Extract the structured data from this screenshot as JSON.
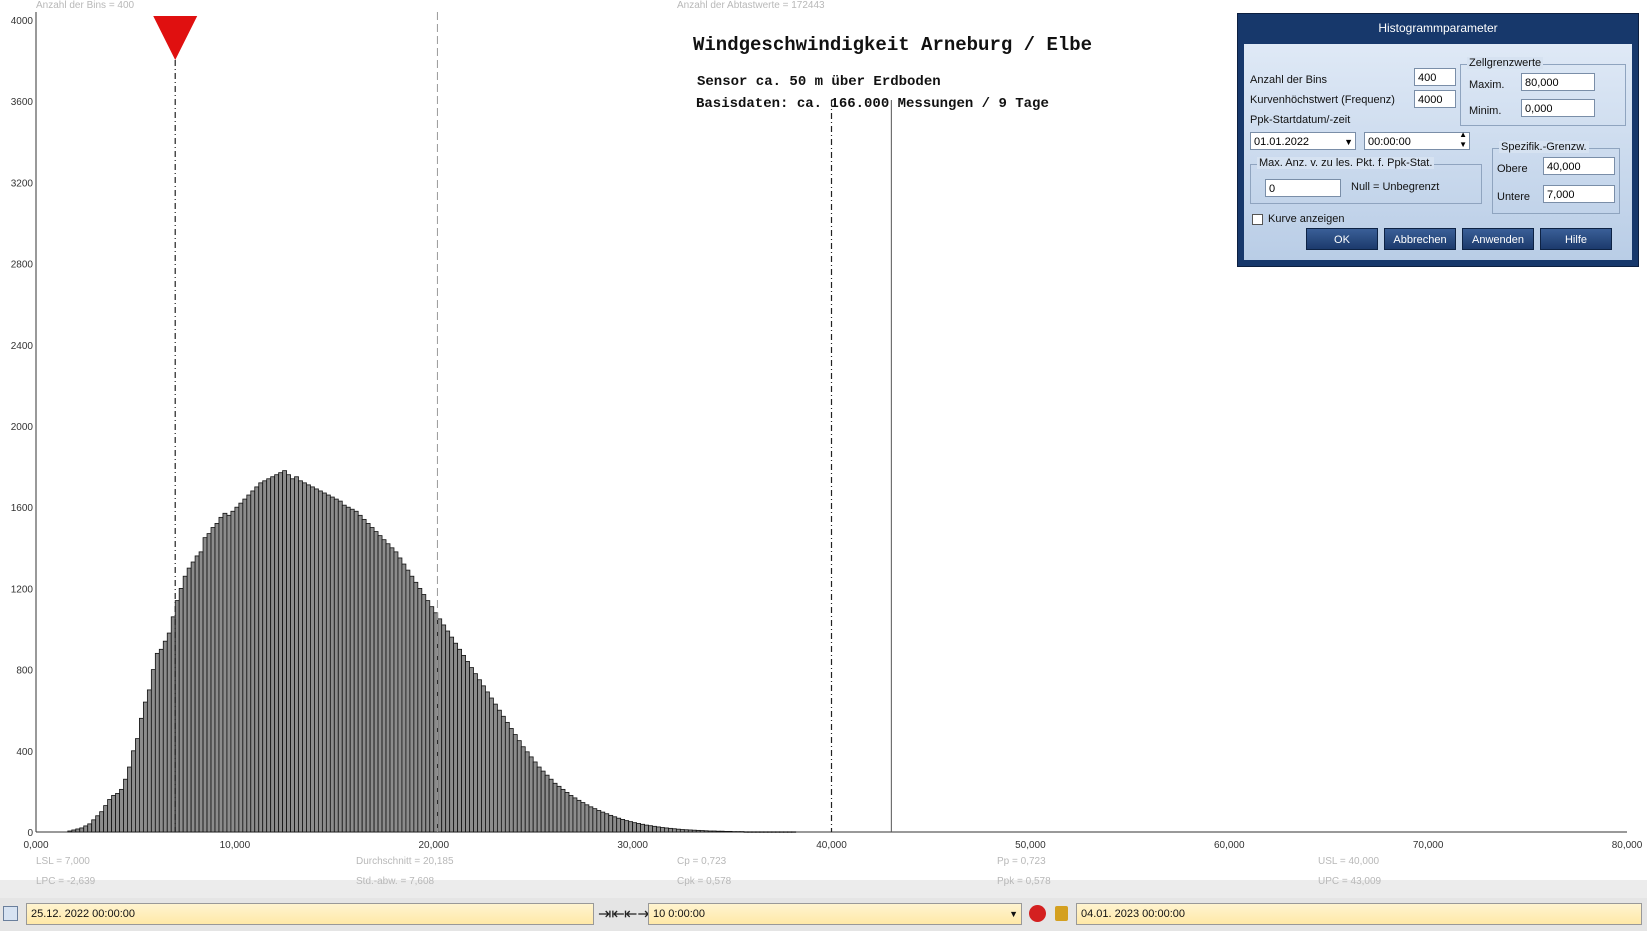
{
  "top_labels": {
    "bins": "Anzahl der Bins =   400",
    "samples": "Anzahl der Abtastwerte = 172443"
  },
  "chart_data": {
    "type": "bar",
    "title": "Windgeschwindigkeit  Arneburg / Elbe",
    "subtitle_1": "Sensor ca. 50 m über Erdboden",
    "subtitle_2": "Basisdaten:  ca. 166.000 Messungen / 9 Tage",
    "xlim": [
      0,
      80
    ],
    "ylim": [
      0,
      4000
    ],
    "x_ticks": [
      "0,000",
      "10,000",
      "20,000",
      "30,000",
      "40,000",
      "50,000",
      "60,000",
      "70,000",
      "80,000"
    ],
    "y_ticks": [
      "0",
      "400",
      "800",
      "1200",
      "1600",
      "2000",
      "2400",
      "2800",
      "3200",
      "3600",
      "4000"
    ],
    "bin_width": 0.2,
    "bin_start": 1.6,
    "values": [
      5,
      10,
      15,
      20,
      30,
      40,
      60,
      80,
      100,
      130,
      160,
      180,
      190,
      210,
      260,
      320,
      400,
      460,
      560,
      640,
      700,
      800,
      880,
      900,
      940,
      980,
      1060,
      1140,
      1200,
      1260,
      1300,
      1330,
      1360,
      1380,
      1450,
      1470,
      1500,
      1520,
      1550,
      1570,
      1560,
      1580,
      1600,
      1620,
      1640,
      1660,
      1680,
      1700,
      1720,
      1730,
      1740,
      1750,
      1760,
      1770,
      1780,
      1760,
      1740,
      1750,
      1730,
      1720,
      1710,
      1700,
      1690,
      1680,
      1670,
      1660,
      1650,
      1640,
      1630,
      1610,
      1600,
      1590,
      1580,
      1560,
      1540,
      1520,
      1500,
      1480,
      1460,
      1440,
      1420,
      1400,
      1380,
      1350,
      1320,
      1290,
      1260,
      1230,
      1200,
      1170,
      1140,
      1110,
      1080,
      1050,
      1020,
      990,
      960,
      930,
      900,
      870,
      840,
      810,
      780,
      750,
      720,
      690,
      660,
      630,
      600,
      570,
      540,
      510,
      480,
      450,
      420,
      395,
      370,
      345,
      320,
      300,
      280,
      260,
      240,
      225,
      210,
      195,
      180,
      168,
      156,
      145,
      134,
      124,
      115,
      106,
      98,
      90,
      82,
      75,
      68,
      62,
      56,
      51,
      46,
      42,
      38,
      34,
      31,
      28,
      25,
      22,
      20,
      18,
      16,
      14,
      12,
      11,
      10,
      9,
      8,
      7,
      6,
      5,
      5,
      4,
      4,
      3,
      3,
      2,
      2,
      2,
      1,
      1,
      1,
      1,
      1,
      1,
      1,
      1,
      1,
      1,
      1,
      1,
      1
    ],
    "markers": {
      "lsl": 7.0,
      "mean": 20.185,
      "usl": 40.0,
      "upc": 43.009
    }
  },
  "stats": {
    "lsl": "LSL = 7,000",
    "lpc": "LPC = -2,639",
    "mean": "Durchschnitt  = 20,185",
    "std": "Std.-abw. = 7,608",
    "cp": "Cp  = 0,723",
    "cpk": "Cpk = 0,578",
    "pp": "Pp  = 0,723",
    "ppk": "Ppk = 0,578",
    "usl": "USL = 40,000",
    "upc": "UPC = 43,009"
  },
  "dialog": {
    "title": "Histogrammparameter",
    "bins_label": "Anzahl der Bins",
    "bins_value": "400",
    "maxfreq_label": "Kurvenhöchstwert (Frequenz)",
    "maxfreq_value": "4000",
    "ppk_label": "Ppk-Startdatum/-zeit",
    "start_date": "01.01.2022",
    "start_time": "00:00:00",
    "cell_group": "Zellgrenzwerte",
    "max_label": "Maxim.",
    "max_value": "80,000",
    "min_label": "Minim.",
    "min_value": "0,000",
    "maxcount_group": "Max. Anz. v. zu les. Pkt. f. Ppk-Stat.",
    "maxcount_value": "0",
    "maxcount_hint": "Null = Unbegrenzt",
    "spec_group": "Spezifik.-Grenzw.",
    "upper_label": "Obere",
    "upper_value": "40,000",
    "lower_label": "Untere",
    "lower_value": "7,000",
    "curve_label": "Kurve anzeigen",
    "ok": "OK",
    "cancel": "Abbrechen",
    "apply": "Anwenden",
    "help": "Hilfe"
  },
  "bottombar": {
    "start": "25.12. 2022   00:00:00",
    "interval": "10  0:00:00",
    "end": "04.01. 2023    00:00:00"
  },
  "colors": {
    "bar_fill": "#8c8c8c",
    "marker": "#e01010",
    "dialog": "#17386b"
  }
}
